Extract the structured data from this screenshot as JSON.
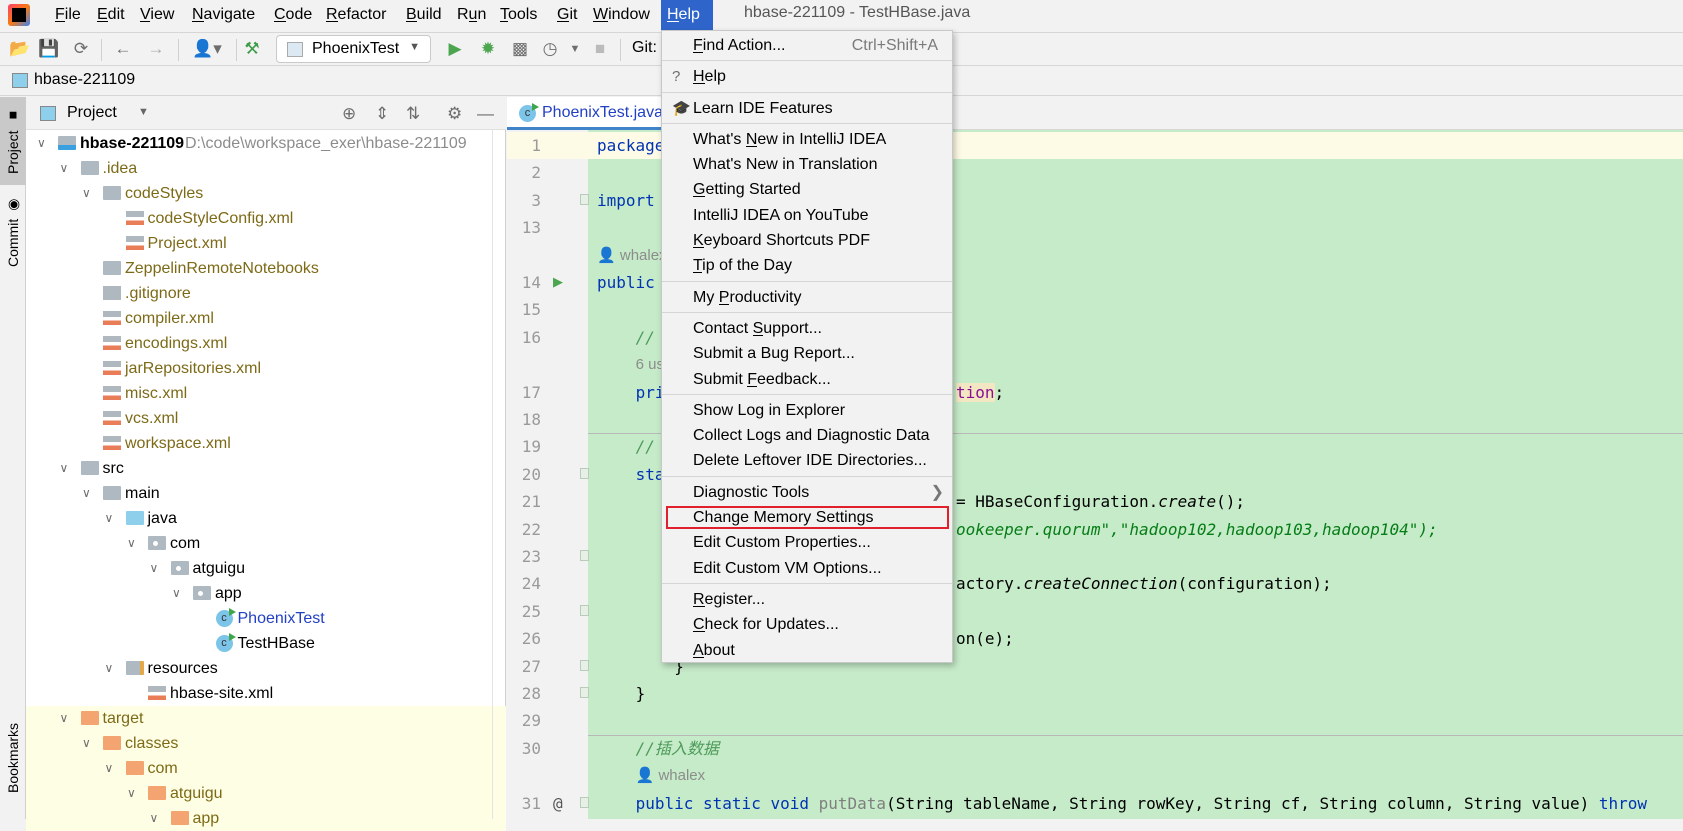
{
  "menubar": {
    "items": [
      {
        "label": "File",
        "mnemonic": "F"
      },
      {
        "label": "Edit",
        "mnemonic": "E"
      },
      {
        "label": "View",
        "mnemonic": "V"
      },
      {
        "label": "Navigate",
        "mnemonic": "N"
      },
      {
        "label": "Code",
        "mnemonic": "C"
      },
      {
        "label": "Refactor",
        "mnemonic": "R"
      },
      {
        "label": "Build",
        "mnemonic": "B"
      },
      {
        "label": "Run",
        "mnemonic": "u"
      },
      {
        "label": "Tools",
        "mnemonic": "T"
      },
      {
        "label": "Git",
        "mnemonic": "G"
      },
      {
        "label": "Window",
        "mnemonic": "W"
      },
      {
        "label": "Help",
        "mnemonic": "H"
      }
    ],
    "window_title": "hbase-221109 - TestHBase.java"
  },
  "toolbar": {
    "run_config": "PhoenixTest",
    "git_label": "Git:"
  },
  "breadcrumb": {
    "project": "hbase-221109"
  },
  "sidebar_tabs": {
    "project": "Project",
    "commit": "Commit",
    "bookmarks": "Bookmarks"
  },
  "project_panel": {
    "title": "Project",
    "root_path": "D:\\code\\workspace_exer\\hbase-221109",
    "tree": [
      {
        "label": "hbase-221109",
        "level": 0,
        "icon": "module-folder",
        "expanded": true,
        "style": "bold"
      },
      {
        "label": ".idea",
        "level": 1,
        "icon": "folder",
        "expanded": true,
        "style": "olive"
      },
      {
        "label": "codeStyles",
        "level": 2,
        "icon": "folder",
        "expanded": true,
        "style": "olive"
      },
      {
        "label": "codeStyleConfig.xml",
        "level": 3,
        "icon": "xml",
        "style": "olive"
      },
      {
        "label": "Project.xml",
        "level": 3,
        "icon": "xml",
        "style": "olive"
      },
      {
        "label": "ZeppelinRemoteNotebooks",
        "level": 2,
        "icon": "folder",
        "style": "olive"
      },
      {
        "label": ".gitignore",
        "level": 2,
        "icon": "gitignore",
        "style": "olive"
      },
      {
        "label": "compiler.xml",
        "level": 2,
        "icon": "xml",
        "style": "olive"
      },
      {
        "label": "encodings.xml",
        "level": 2,
        "icon": "xml",
        "style": "olive"
      },
      {
        "label": "jarRepositories.xml",
        "level": 2,
        "icon": "xml",
        "style": "olive"
      },
      {
        "label": "misc.xml",
        "level": 2,
        "icon": "xml",
        "style": "olive"
      },
      {
        "label": "vcs.xml",
        "level": 2,
        "icon": "xml",
        "style": "olive"
      },
      {
        "label": "workspace.xml",
        "level": 2,
        "icon": "xml",
        "style": "olive"
      },
      {
        "label": "src",
        "level": 1,
        "icon": "folder",
        "expanded": true,
        "style": "normal"
      },
      {
        "label": "main",
        "level": 2,
        "icon": "folder",
        "expanded": true,
        "style": "normal"
      },
      {
        "label": "java",
        "level": 3,
        "icon": "source-folder",
        "expanded": true,
        "style": "normal"
      },
      {
        "label": "com",
        "level": 4,
        "icon": "package",
        "expanded": true,
        "style": "normal"
      },
      {
        "label": "atguigu",
        "level": 5,
        "icon": "package",
        "expanded": true,
        "style": "normal"
      },
      {
        "label": "app",
        "level": 6,
        "icon": "package",
        "expanded": true,
        "style": "normal"
      },
      {
        "label": "PhoenixTest",
        "level": 7,
        "icon": "java-class",
        "style": "blue"
      },
      {
        "label": "TestHBase",
        "level": 7,
        "icon": "java-class",
        "style": "normal"
      },
      {
        "label": "resources",
        "level": 3,
        "icon": "resources-folder",
        "expanded": true,
        "style": "normal"
      },
      {
        "label": "hbase-site.xml",
        "level": 4,
        "icon": "xml",
        "style": "normal"
      },
      {
        "label": "target",
        "level": 1,
        "icon": "excluded-folder",
        "expanded": true,
        "style": "olive",
        "excluded": true
      },
      {
        "label": "classes",
        "level": 2,
        "icon": "excluded-folder",
        "expanded": true,
        "style": "olive",
        "excluded": true
      },
      {
        "label": "com",
        "level": 3,
        "icon": "excluded-folder",
        "expanded": true,
        "style": "olive",
        "excluded": true
      },
      {
        "label": "atguigu",
        "level": 4,
        "icon": "excluded-folder",
        "expanded": true,
        "style": "olive",
        "excluded": true
      },
      {
        "label": "app",
        "level": 5,
        "icon": "excluded-folder",
        "expanded": true,
        "style": "olive",
        "excluded": true
      }
    ]
  },
  "editor": {
    "tab": "PhoenixTest.java",
    "rows": [
      {
        "num": "1",
        "caret": true,
        "indent": 0,
        "left": [
          {
            "t": "package",
            "c": "kw"
          }
        ]
      },
      {
        "num": "2",
        "indent": 0,
        "left": []
      },
      {
        "num": "3",
        "fold": true,
        "indent": 0,
        "left": [
          {
            "t": "import",
            "c": "kw"
          }
        ]
      },
      {
        "num": "13",
        "indent": 0,
        "left": []
      },
      {
        "num": "",
        "hint": "whalex",
        "indent": 0,
        "left": []
      },
      {
        "num": "14",
        "run": true,
        "indent": 0,
        "left": [
          {
            "t": "public",
            "c": "kw"
          }
        ]
      },
      {
        "num": "15",
        "indent": 0,
        "left": []
      },
      {
        "num": "16",
        "indent": 4,
        "left": [
          {
            "t": "//",
            "c": "cm"
          }
        ]
      },
      {
        "num": "",
        "hint": "6 us",
        "indent": 4,
        "left": []
      },
      {
        "num": "17",
        "indent": 4,
        "left": [
          {
            "t": "pri",
            "c": "kw"
          }
        ],
        "right": [
          {
            "t": "tion",
            "c": "fld"
          },
          {
            "t": ";",
            "c": ""
          }
        ]
      },
      {
        "num": "18",
        "indent": 0,
        "left": [],
        "sep_after": true
      },
      {
        "num": "19",
        "indent": 4,
        "left": [
          {
            "t": "//",
            "c": "cm"
          }
        ]
      },
      {
        "num": "20",
        "fold": true,
        "indent": 4,
        "left": [
          {
            "t": "sta",
            "c": "kw"
          }
        ]
      },
      {
        "num": "21",
        "indent": 0,
        "left": [],
        "right": [
          {
            "t": "= HBaseConfiguration.",
            "c": ""
          },
          {
            "t": "create",
            "c": "it"
          },
          {
            "t": "();",
            "c": ""
          }
        ]
      },
      {
        "num": "22",
        "indent": 0,
        "left": [],
        "right": [
          {
            "t": "ookeeper.quorum\",\"hadoop102,hadoop103,hadoop104\");",
            "c": "str"
          }
        ]
      },
      {
        "num": "23",
        "fold": true,
        "indent": 0,
        "left": []
      },
      {
        "num": "24",
        "indent": 0,
        "left": [],
        "right": [
          {
            "t": "actory.",
            "c": ""
          },
          {
            "t": "createConnection",
            "c": "it"
          },
          {
            "t": "(configuration);",
            "c": ""
          }
        ]
      },
      {
        "num": "25",
        "fold": true,
        "indent": 0,
        "left": []
      },
      {
        "num": "26",
        "indent": 0,
        "left": [],
        "right": [
          {
            "t": "on(e);",
            "c": ""
          }
        ]
      },
      {
        "num": "27",
        "fold": true,
        "indent": 8,
        "left": [
          {
            "t": "}",
            "c": ""
          }
        ]
      },
      {
        "num": "28",
        "fold": true,
        "indent": 4,
        "left": [
          {
            "t": "}",
            "c": ""
          }
        ]
      },
      {
        "num": "29",
        "indent": 0,
        "left": [],
        "sep_after": true
      },
      {
        "num": "30",
        "indent": 4,
        "left": [
          {
            "t": "//插入数据",
            "c": "cm"
          }
        ]
      },
      {
        "num": "",
        "hint": "whalex",
        "indent": 4,
        "left": []
      },
      {
        "num": "31",
        "at": true,
        "fold": true,
        "indent": 4,
        "left": [
          {
            "t": "public static void ",
            "c": "kw"
          },
          {
            "t": "putData",
            "c": "gray"
          },
          {
            "t": "(String tableName, String rowKey, String cf, String column, String value) ",
            "c": ""
          },
          {
            "t": "throw",
            "c": "kw"
          }
        ]
      }
    ]
  },
  "help_menu": {
    "groups": [
      [
        {
          "label": "Find Action...",
          "mnemonic": "F",
          "shortcut": "Ctrl+Shift+A"
        }
      ],
      [
        {
          "label": "Help",
          "mnemonic": "H",
          "icon": "question-icon"
        }
      ],
      [
        {
          "label": "Learn IDE Features",
          "icon": "graduation-cap-icon"
        }
      ],
      [
        {
          "label": "What's New in IntelliJ IDEA",
          "mnemonic": "N"
        },
        {
          "label": "What's New in Translation"
        },
        {
          "label": "Getting Started",
          "mnemonic": "G"
        },
        {
          "label": "IntelliJ IDEA on YouTube"
        },
        {
          "label": "Keyboard Shortcuts PDF",
          "mnemonic": "K"
        },
        {
          "label": "Tip of the Day",
          "mnemonic": "T"
        }
      ],
      [
        {
          "label": "My Productivity",
          "mnemonic": "P"
        }
      ],
      [
        {
          "label": "Contact Support...",
          "mnemonic": "S"
        },
        {
          "label": "Submit a Bug Report..."
        },
        {
          "label": "Submit Feedback...",
          "mnemonic": "F"
        }
      ],
      [
        {
          "label": "Show Log in Explorer"
        },
        {
          "label": "Collect Logs and Diagnostic Data"
        },
        {
          "label": "Delete Leftover IDE Directories..."
        }
      ],
      [
        {
          "label": "Diagnostic Tools",
          "submenu": true
        },
        {
          "label": "Change Memory Settings",
          "highlighted_box": true
        },
        {
          "label": "Edit Custom Properties..."
        },
        {
          "label": "Edit Custom VM Options..."
        }
      ],
      [
        {
          "label": "Register...",
          "mnemonic": "R"
        },
        {
          "label": "Check for Updates...",
          "mnemonic": "C"
        },
        {
          "label": "About",
          "mnemonic": "A"
        }
      ]
    ],
    "highlight_color": "#e0202a"
  },
  "colors": {
    "menu_active": "#2f65ca",
    "editor_bg": "#c6ebc9",
    "excluded_bg": "#fefee4"
  }
}
